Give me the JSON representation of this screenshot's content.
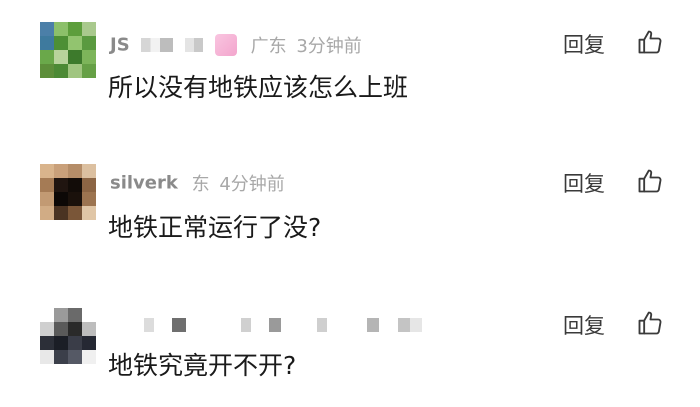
{
  "comments": [
    {
      "user": "JS",
      "location": "广东",
      "time": "3分钟前",
      "text": "所以没有地铁应该怎么上班",
      "reply_label": "回复",
      "like_icon": "thumbs-up-icon"
    },
    {
      "user": "silverk",
      "location": "东",
      "time": "4分钟前",
      "text": "地铁正常运行了没?",
      "reply_label": "回复",
      "like_icon": "thumbs-up-icon"
    },
    {
      "user": "",
      "location": "",
      "time": "",
      "text": "地铁究竟开不开?",
      "reply_label": "回复",
      "like_icon": "thumbs-up-icon"
    }
  ]
}
